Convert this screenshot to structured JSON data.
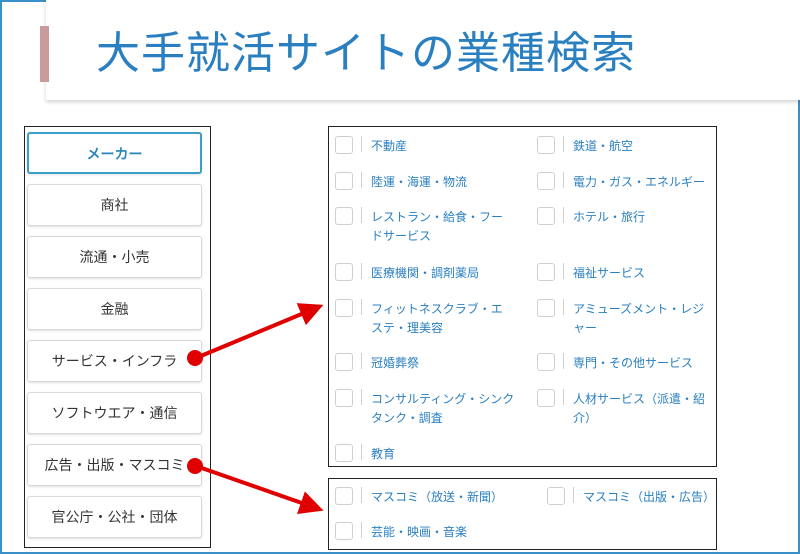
{
  "title": "大手就活サイトの業種検索",
  "sidebar": {
    "items": [
      {
        "label": "メーカー",
        "active": true
      },
      {
        "label": "商社"
      },
      {
        "label": "流通・小売"
      },
      {
        "label": "金融"
      },
      {
        "label": "サービス・インフラ"
      },
      {
        "label": "ソフトウエア・通信"
      },
      {
        "label": "広告・出版・マスコミ"
      },
      {
        "label": "官公庁・公社・団体"
      }
    ]
  },
  "services_panel": {
    "options": [
      {
        "label": "不動産",
        "checked": false
      },
      {
        "label": "鉄道・航空",
        "checked": false
      },
      {
        "label": "陸運・海運・物流",
        "checked": false
      },
      {
        "label": "電力・ガス・エネルギー",
        "checked": false
      },
      {
        "label": "レストラン・給食・フードサービス",
        "checked": false
      },
      {
        "label": "ホテル・旅行",
        "checked": false
      },
      {
        "label": "医療機関・調剤薬局",
        "checked": false
      },
      {
        "label": "福祉サービス",
        "checked": false
      },
      {
        "label": "フィットネスクラブ・エステ・理美容",
        "checked": false
      },
      {
        "label": "アミューズメント・レジャー",
        "checked": false
      },
      {
        "label": "冠婚葬祭",
        "checked": false
      },
      {
        "label": "専門・その他サービス",
        "checked": false
      },
      {
        "label": "コンサルティング・シンクタンク・調査",
        "checked": false
      },
      {
        "label": "人材サービス（派遣・紹介）",
        "checked": false
      },
      {
        "label": "教育",
        "checked": false
      }
    ]
  },
  "media_panel": {
    "options": [
      {
        "label": "マスコミ（放送・新聞）",
        "checked": false
      },
      {
        "label": "マスコミ（出版・広告）",
        "checked": false
      },
      {
        "label": "芸能・映画・音楽",
        "checked": false
      }
    ]
  },
  "colors": {
    "accent": "#2a7fc0",
    "title_bar": "#c79b9b",
    "annotation": "#e00000",
    "active_border": "#3aa0c9"
  }
}
